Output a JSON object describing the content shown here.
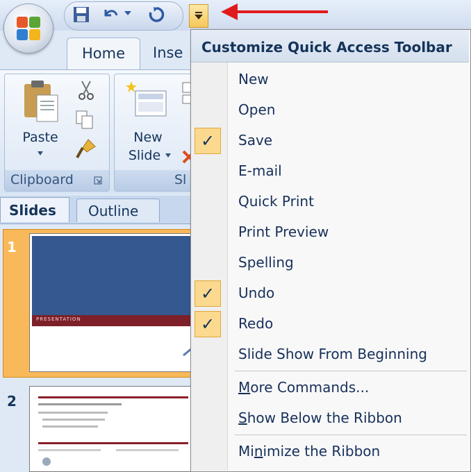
{
  "ribbon": {
    "tabs": [
      "Home",
      "Inse"
    ],
    "clipboard": {
      "paste": "Paste",
      "label": "Clipboard"
    },
    "slides": {
      "new_line1": "New",
      "new_line2": "Slide",
      "label": "Sl"
    }
  },
  "slide_pane": {
    "tabs": [
      "Slides",
      "Outline"
    ],
    "slide_numbers": [
      "1",
      "2"
    ],
    "slide1_text": "PRESENTATION"
  },
  "menu": {
    "title": "Customize Quick Access Toolbar",
    "items": [
      {
        "label": "New",
        "checked": false
      },
      {
        "label": "Open",
        "checked": false
      },
      {
        "label": "Save",
        "checked": true
      },
      {
        "label": "E-mail",
        "checked": false
      },
      {
        "label": "Quick Print",
        "checked": false
      },
      {
        "label": "Print Preview",
        "checked": false
      },
      {
        "label": "Spelling",
        "checked": false
      },
      {
        "label": "Undo",
        "checked": true
      },
      {
        "label": "Redo",
        "checked": true
      },
      {
        "label": "Slide Show From Beginning",
        "checked": false
      }
    ],
    "more_commands": {
      "pre": "",
      "ul": "M",
      "post": "ore Commands..."
    },
    "show_below": {
      "pre": "",
      "ul": "S",
      "post": "how Below the Ribbon"
    },
    "minimize": {
      "pre": "Mi",
      "ul": "n",
      "post": "imize the Ribbon"
    },
    "check_glyph": "✓"
  },
  "colors": {
    "annotation_arrow": "#e01b1b",
    "check_bg": "#fbd98e"
  }
}
